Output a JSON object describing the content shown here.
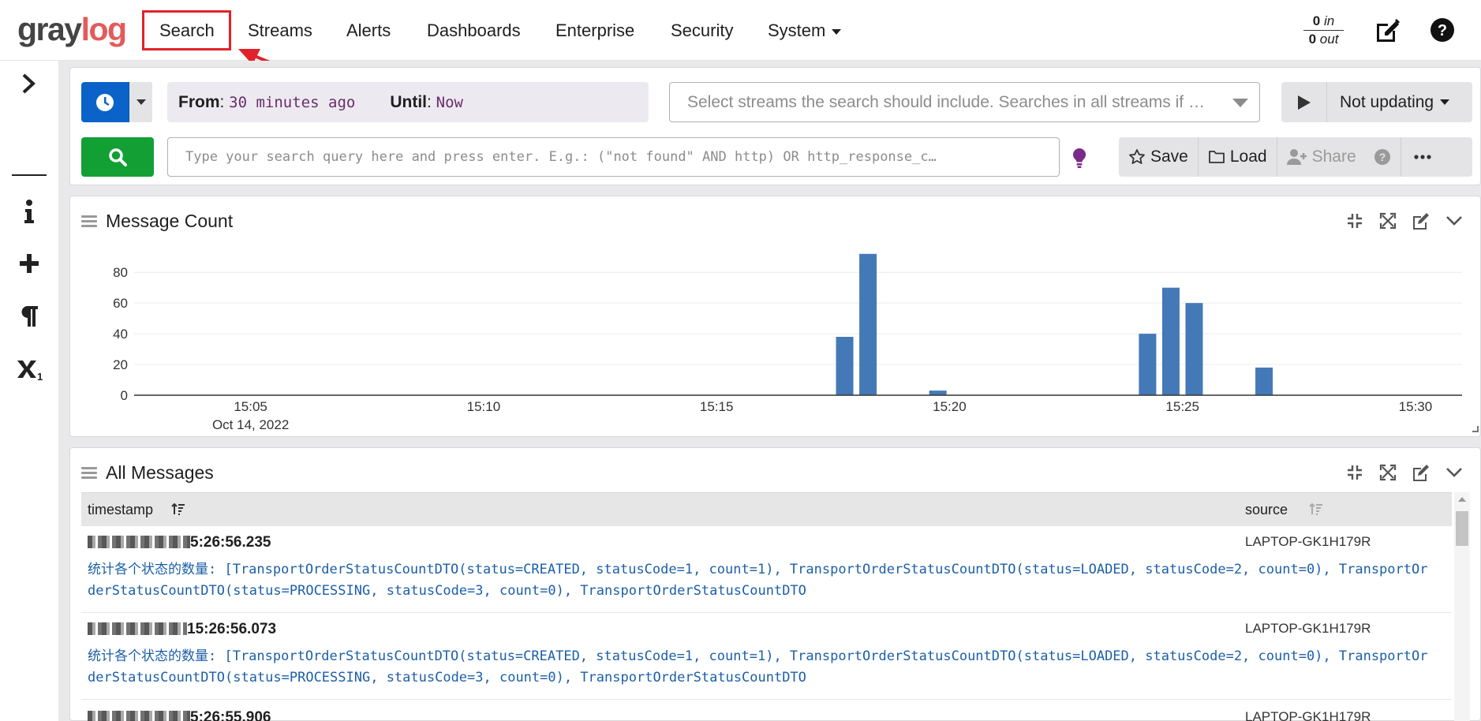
{
  "app": {
    "logo_left": "gray",
    "logo_right": "log"
  },
  "nav": {
    "items": [
      "Search",
      "Streams",
      "Alerts",
      "Dashboards",
      "Enterprise",
      "Security",
      "System"
    ],
    "active": "Search",
    "throughput": {
      "in_value": "0",
      "in_label": "in",
      "out_value": "0",
      "out_label": "out"
    }
  },
  "sidebar": {
    "icons": [
      "chevron-right-icon",
      "info-icon",
      "plus-icon",
      "paragraph-icon",
      "subscript-icon"
    ]
  },
  "search": {
    "from_label": "From",
    "from_value": "30 minutes ago",
    "until_label": "Until",
    "until_value": "Now",
    "streams_placeholder": "Select streams the search should include. Searches in all streams if …",
    "refresh_label": "Not updating",
    "query_placeholder": "Type your search query here and press enter. E.g.: (\"not found\" AND http) OR http_response_c…",
    "save_label": "Save",
    "load_label": "Load",
    "share_label": "Share"
  },
  "message_count": {
    "title": "Message Count"
  },
  "chart_data": {
    "type": "bar",
    "title": "",
    "xlabel": "",
    "ylabel": "",
    "ylim": [
      0,
      95
    ],
    "yticks": [
      0,
      20,
      40,
      60,
      80
    ],
    "xticks": [
      "15:05",
      "15:10",
      "15:15",
      "15:20",
      "15:25",
      "15:30"
    ],
    "date_label": "Oct 14, 2022",
    "categories": [
      "15:17:30",
      "15:18:00",
      "15:19:30",
      "15:24:00",
      "15:24:30",
      "15:25:00",
      "15:26:30"
    ],
    "values": [
      38,
      92,
      3,
      40,
      70,
      60,
      18
    ],
    "bar_color": "#4479b8"
  },
  "all_messages": {
    "title": "All Messages",
    "columns": [
      "timestamp",
      "source"
    ],
    "rows": [
      {
        "timestamp": "5:26:56.235",
        "source": "LAPTOP-GK1H179R",
        "message": "统计各个状态的数量: [TransportOrderStatusCountDTO(status=CREATED, statusCode=1, count=1), TransportOrderStatusCountDTO(status=LOADED, statusCode=2, count=0), TransportOrderStatusCountDTO(status=PROCESSING, statusCode=3, count=0), TransportOrderStatusCountDTO"
      },
      {
        "timestamp": "15:26:56.073",
        "source": "LAPTOP-GK1H179R",
        "message": "统计各个状态的数量: [TransportOrderStatusCountDTO(status=CREATED, statusCode=1, count=1), TransportOrderStatusCountDTO(status=LOADED, statusCode=2, count=0), TransportOrderStatusCountDTO(status=PROCESSING, statusCode=3, count=0), TransportOrderStatusCountDTO"
      },
      {
        "timestamp": "5:26:55.906",
        "source": "LAPTOP-GK1H179R",
        "message": ""
      }
    ]
  },
  "colors": {
    "accent_red": "#e2222b",
    "primary_blue": "#0b62c8",
    "go_green": "#12a035",
    "link_blue": "#1c5fa8"
  }
}
